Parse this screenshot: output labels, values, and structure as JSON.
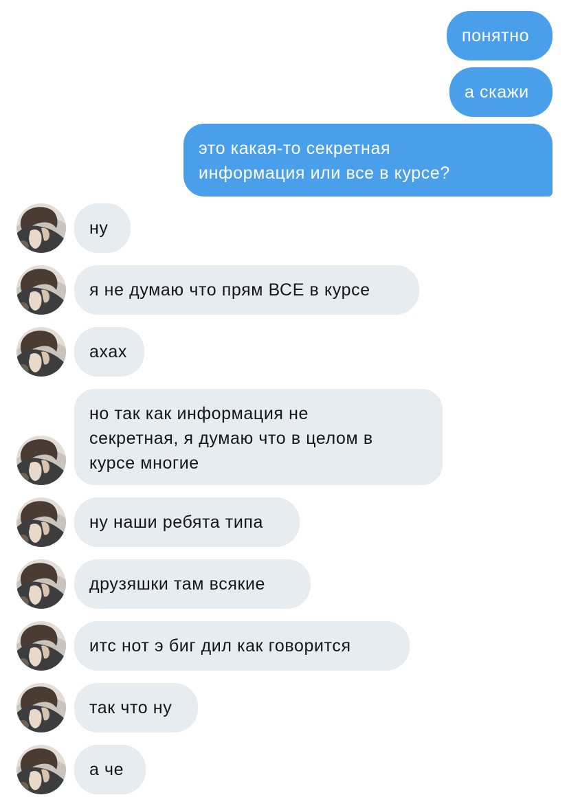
{
  "conversation": {
    "outgoing": [
      {
        "text": "понятно"
      },
      {
        "text": "а скажи"
      },
      {
        "text": "это какая-то секретная\nинформация или все в курсе?"
      }
    ],
    "incoming": [
      {
        "text": "ну",
        "avatar": "user-avatar"
      },
      {
        "text": "я не думаю что прям ВСЕ в курсе",
        "avatar": "user-avatar"
      },
      {
        "text": "ахах",
        "avatar": "user-avatar"
      },
      {
        "text": "но так как информация не\nсекретная, я думаю что в целом в\nкурсе многие",
        "avatar": "user-avatar"
      },
      {
        "text": "ну наши ребята типа",
        "avatar": "user-avatar"
      },
      {
        "text": "друзяшки там всякие",
        "avatar": "user-avatar"
      },
      {
        "text": "итс нот э биг дил как говорится",
        "avatar": "user-avatar"
      },
      {
        "text": "так что ну",
        "avatar": "user-avatar"
      },
      {
        "text": "а че",
        "avatar": "user-avatar"
      }
    ]
  },
  "colors": {
    "outgoing_bubble": "#4a9feb",
    "incoming_bubble": "#e7ecf0",
    "outgoing_text": "#ffffff",
    "incoming_text": "#14171a"
  }
}
